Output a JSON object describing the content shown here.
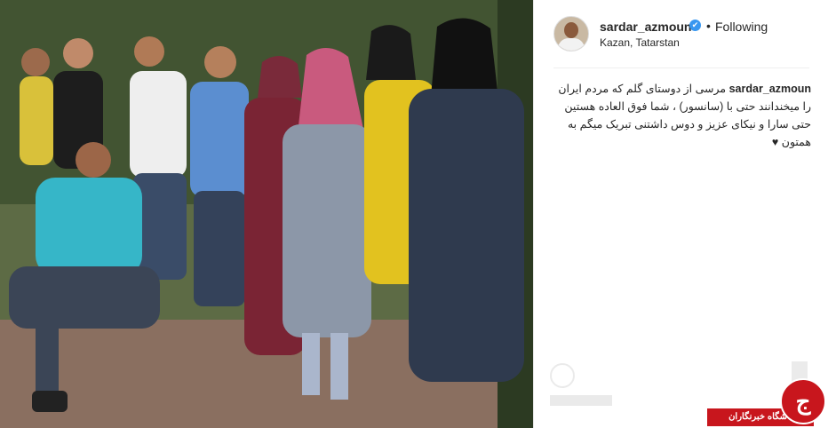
{
  "post": {
    "username": "sardar_azmoun",
    "verified_mark": "✔",
    "separator": "•",
    "follow_status": "Following",
    "location": "Kazan, Tatarstan"
  },
  "caption": {
    "username": "sardar_azmoun",
    "text": "مرسی از دوستای گلم که مردم ایران را میخندانند حتی با (سانسور) ، شما فوق العاده هستین حتی سارا و نیکای عزیز و دوس داشتنی تبریک میگم به همتون ♥"
  },
  "watermark": {
    "label": "باشگاه خبرنگاران",
    "logo_letter": "ج"
  },
  "colors": {
    "verified": "#3897f0",
    "watermark": "#c8161d",
    "text": "#262626"
  }
}
